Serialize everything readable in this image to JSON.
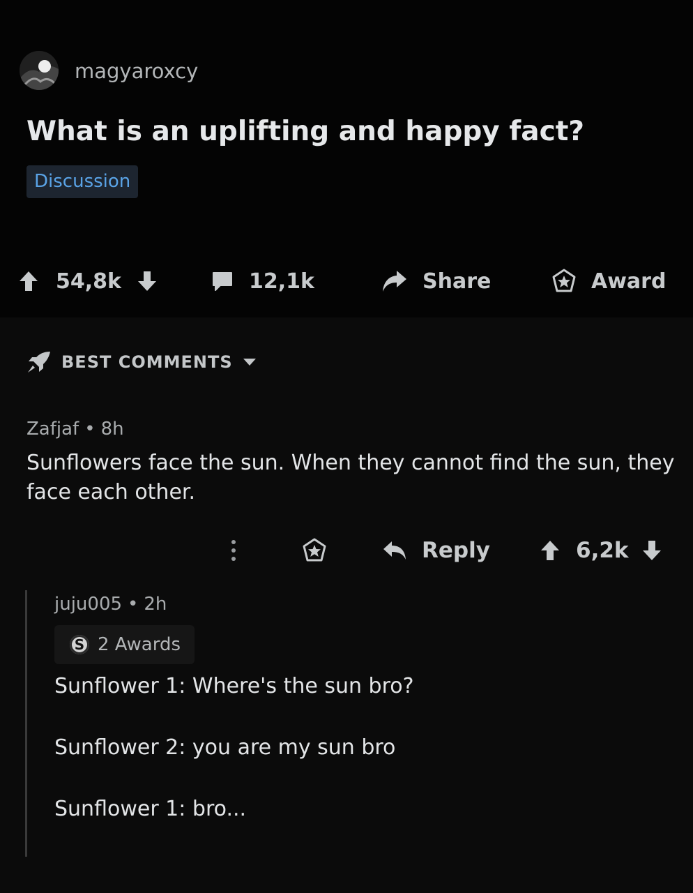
{
  "post": {
    "author": "magyaroxcy",
    "title": "What is an uplifting and happy fact?",
    "flair": "Discussion"
  },
  "actions": {
    "votes": "54,8k",
    "comments": "12,1k",
    "share_label": "Share",
    "award_label": "Award"
  },
  "sort": {
    "label": "BEST COMMENTS"
  },
  "comments": [
    {
      "author": "Zafjaf",
      "separator": "•",
      "age": "8h",
      "body": "Sunflowers face the sun.  When they cannot find the sun, they face each other.",
      "reply_label": "Reply",
      "votes": "6,2k"
    },
    {
      "author": "juju005",
      "separator": "•",
      "age": "2h",
      "awards_label": "2 Awards",
      "award_icon_glyph": "S",
      "lines": [
        "Sunflower 1: Where's the sun bro?",
        "Sunflower 2: you are my sun bro",
        "Sunflower 1: bro..."
      ]
    }
  ],
  "icons": {
    "upvote": "arrow-up-icon",
    "downvote": "arrow-down-icon",
    "comment": "comment-bubble-icon",
    "share": "share-arrow-icon",
    "award": "award-star-icon",
    "sort": "rocket-icon",
    "more": "more-vertical-icon",
    "reply": "reply-arrow-icon"
  },
  "colors": {
    "background": "#000000",
    "flair_text": "#5aa3e6",
    "flair_bg": "#1d2530",
    "text_primary": "#e3e5e7",
    "text_secondary": "#a9acae"
  }
}
